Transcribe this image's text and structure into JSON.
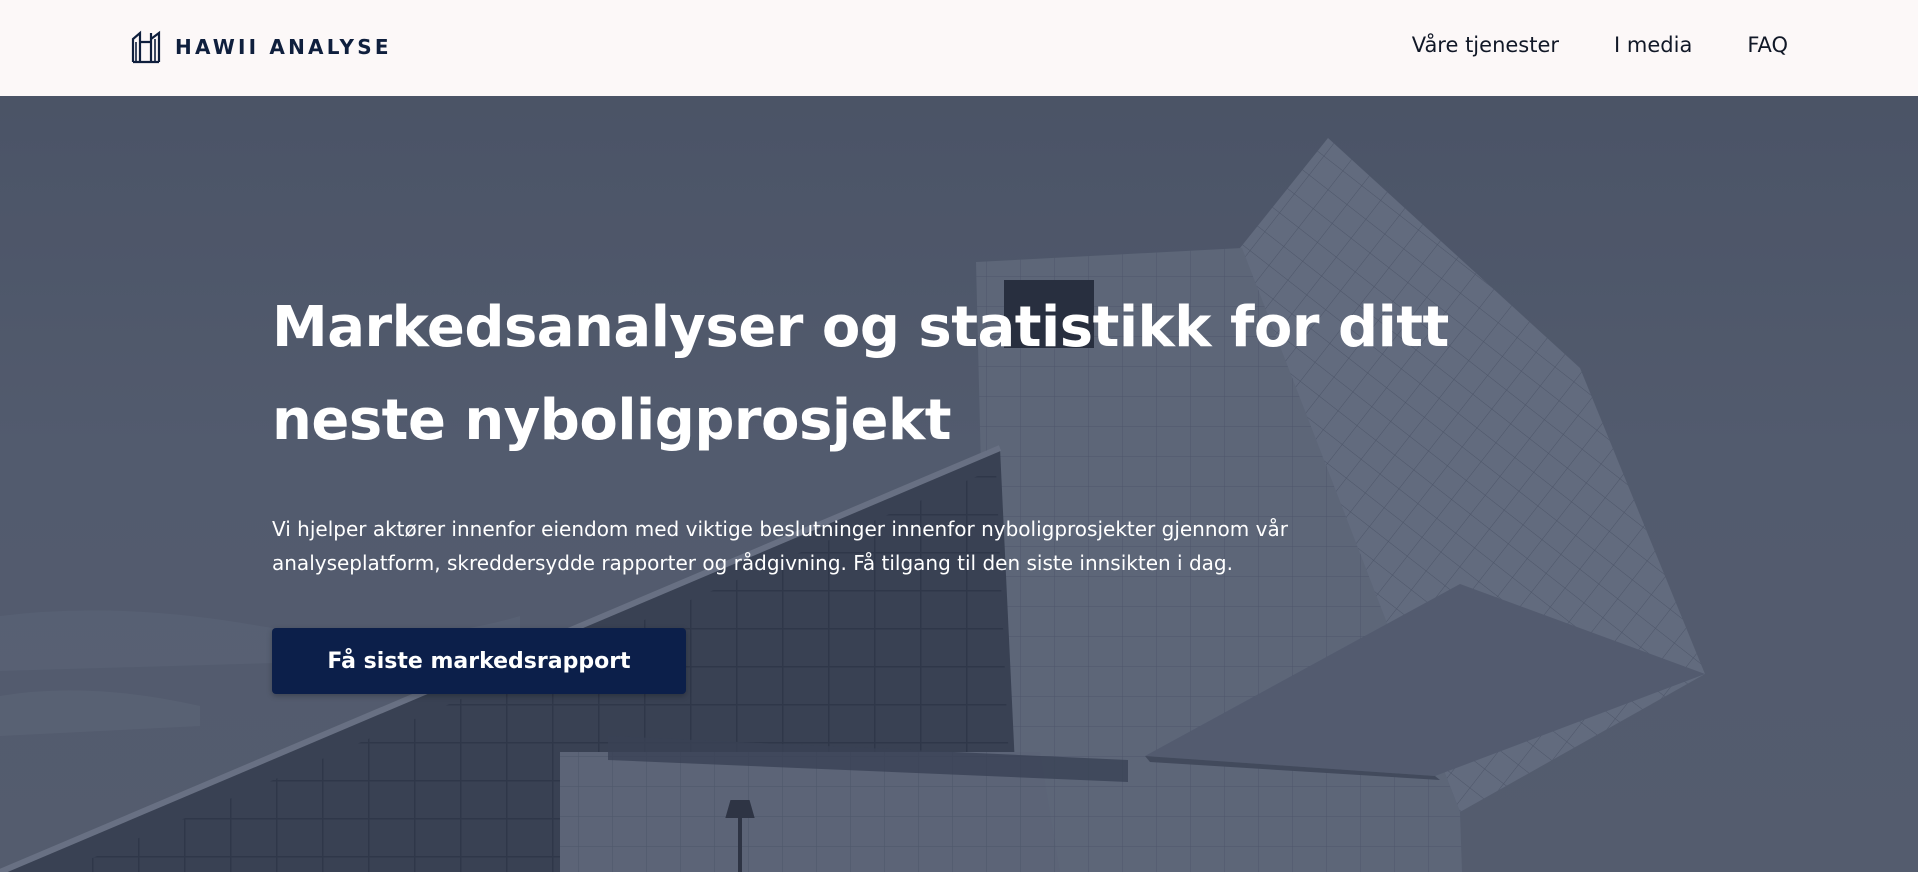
{
  "brand": {
    "name": "HAWII ANALYSE",
    "logo_icon": "hawii-logo-icon",
    "color": "#0f1f3d"
  },
  "nav": {
    "items": [
      {
        "label": "Våre tjenester"
      },
      {
        "label": "I media"
      },
      {
        "label": "FAQ"
      }
    ]
  },
  "hero": {
    "title": "Markedsanalyser og statistikk for ditt neste nyboligprosjekt",
    "description": "Vi hjelper aktører innenfor eiendom med viktige beslutninger innenfor nyboligprosjekter gjennom vår analyseplatform, skreddersydde rapporter og rådgivning. Få tilgang til den siste innsikten i dag.",
    "cta_label": "Få siste markedsrapport",
    "background_image": "modern-building-photo",
    "cta_color": "#0c1f4a"
  }
}
